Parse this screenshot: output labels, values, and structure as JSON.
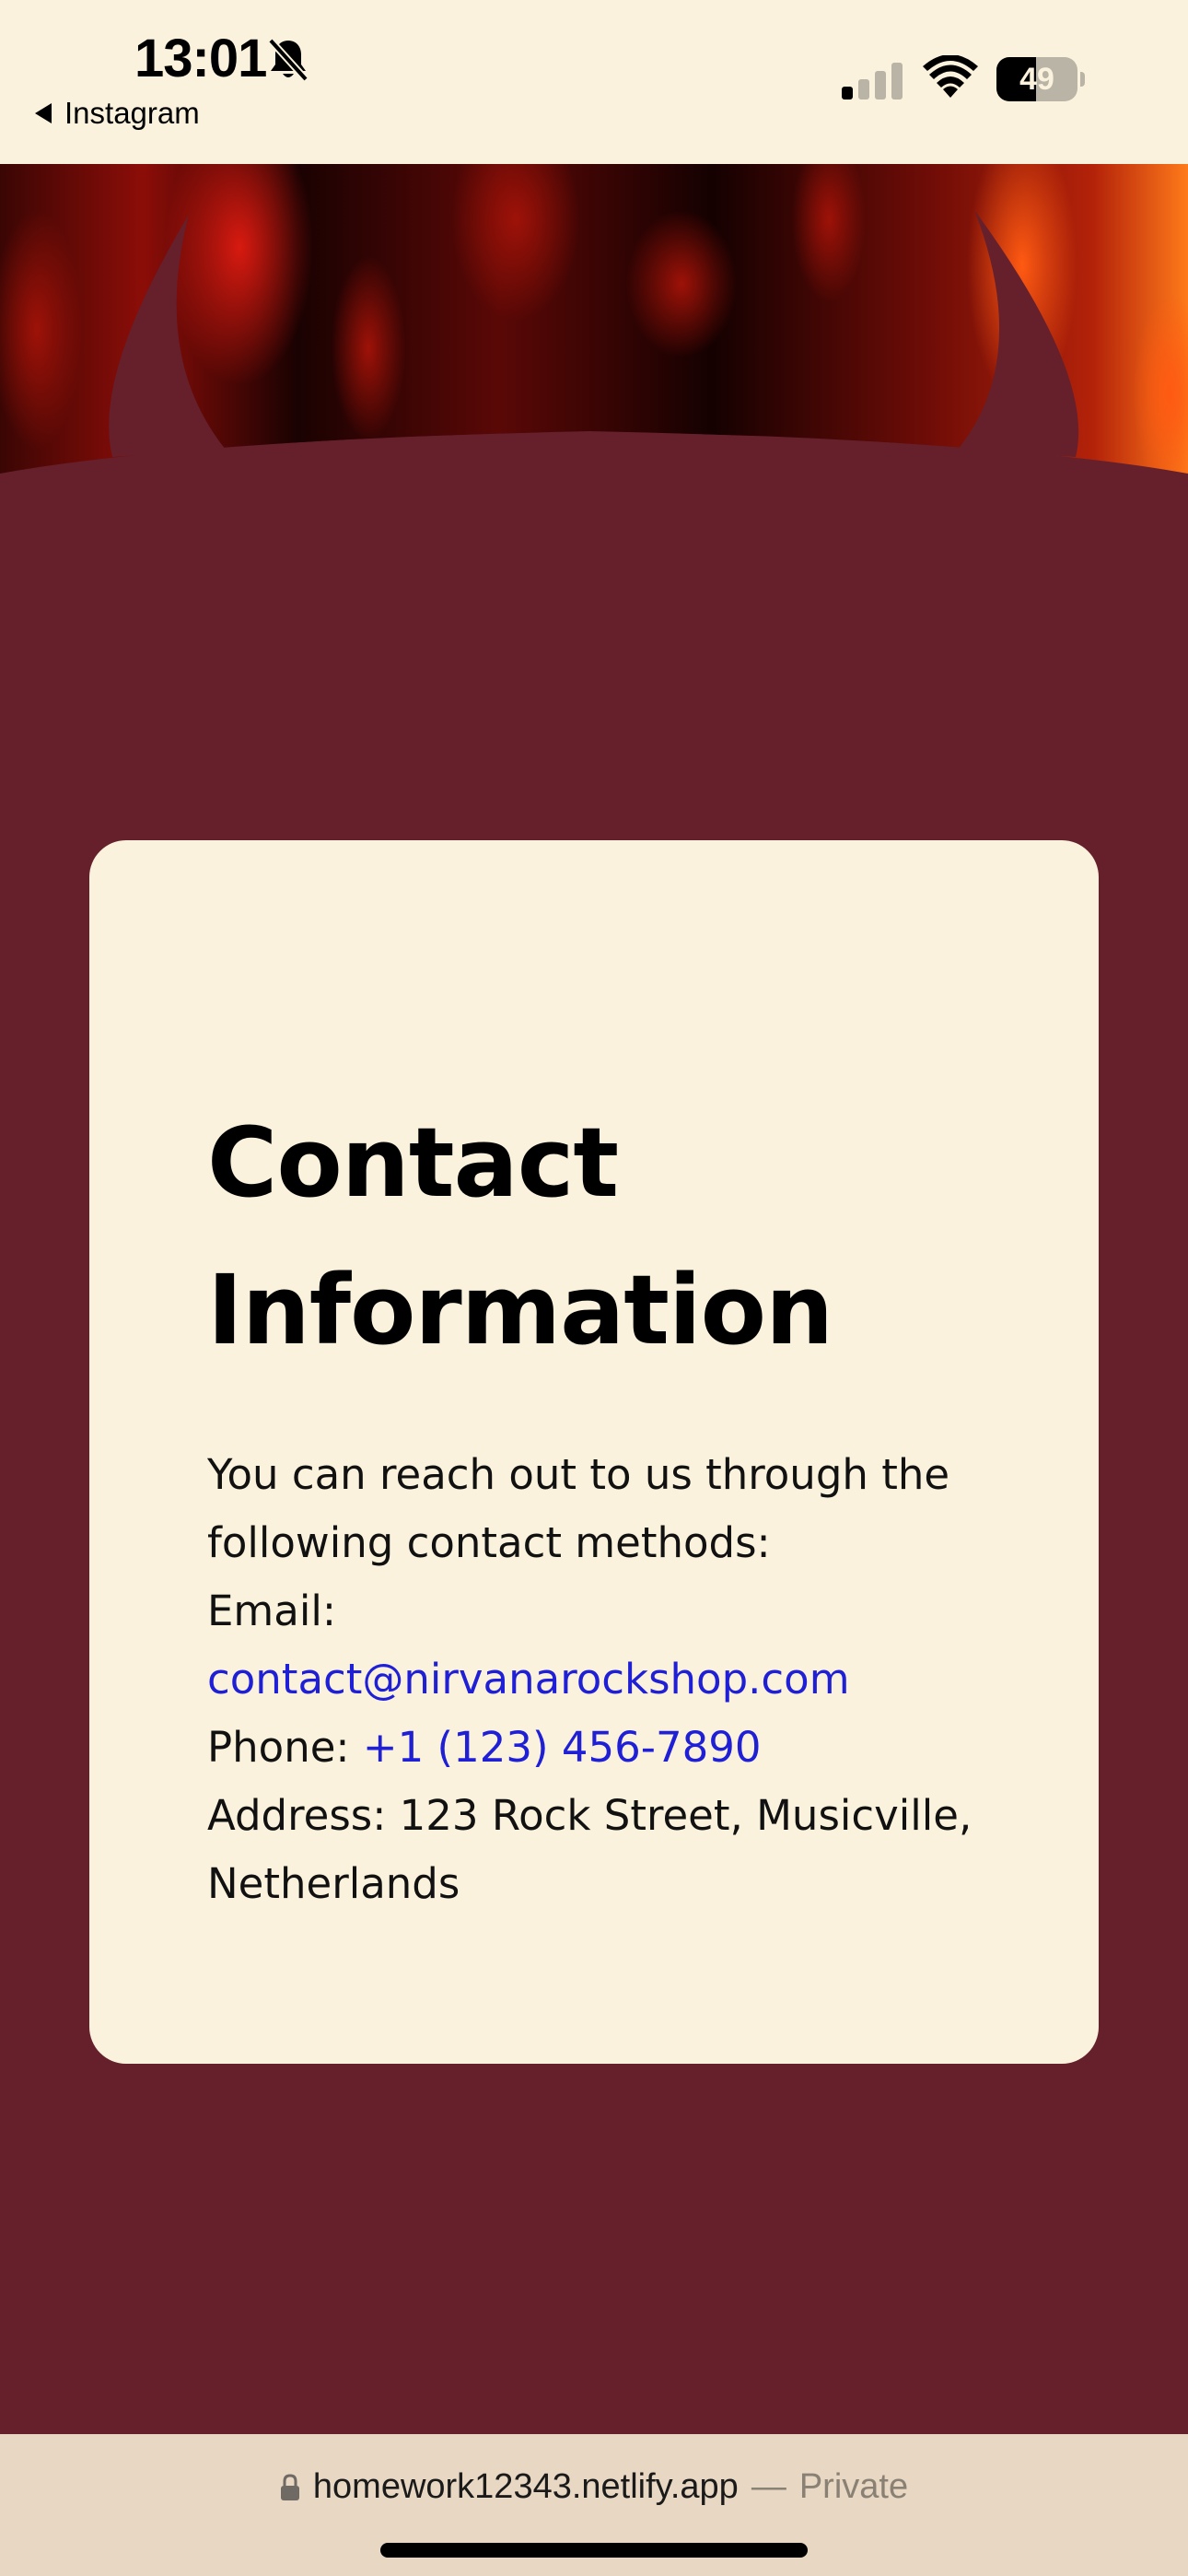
{
  "status_bar": {
    "time": "13:01",
    "back_app": "Instagram",
    "battery_level": "49",
    "battery_fraction": 0.49,
    "icons": [
      "bell-slash-icon",
      "cellular-signal-icon",
      "wifi-icon",
      "battery-icon"
    ]
  },
  "hero": {
    "icons": [
      "devil-horns-icon"
    ]
  },
  "contact": {
    "title": "Contact Information",
    "intro": "You can reach out to us through the following contact methods:",
    "email_label": "Email:",
    "email": "contact@nirvanarockshop.com",
    "phone_label": "Phone:",
    "phone": "+1 (123) 456-7890",
    "address": "Address: 123 Rock Street, Musicville, Netherlands"
  },
  "browser": {
    "url": "homework12343.netlify.app",
    "separator": "—",
    "mode": "Private"
  },
  "colors": {
    "page_background": "#65202c",
    "card_background": "#faf2dc",
    "link": "#1f1fd6",
    "status_bar": "#faf2dc",
    "browser_bar": "#e8d7c2"
  }
}
